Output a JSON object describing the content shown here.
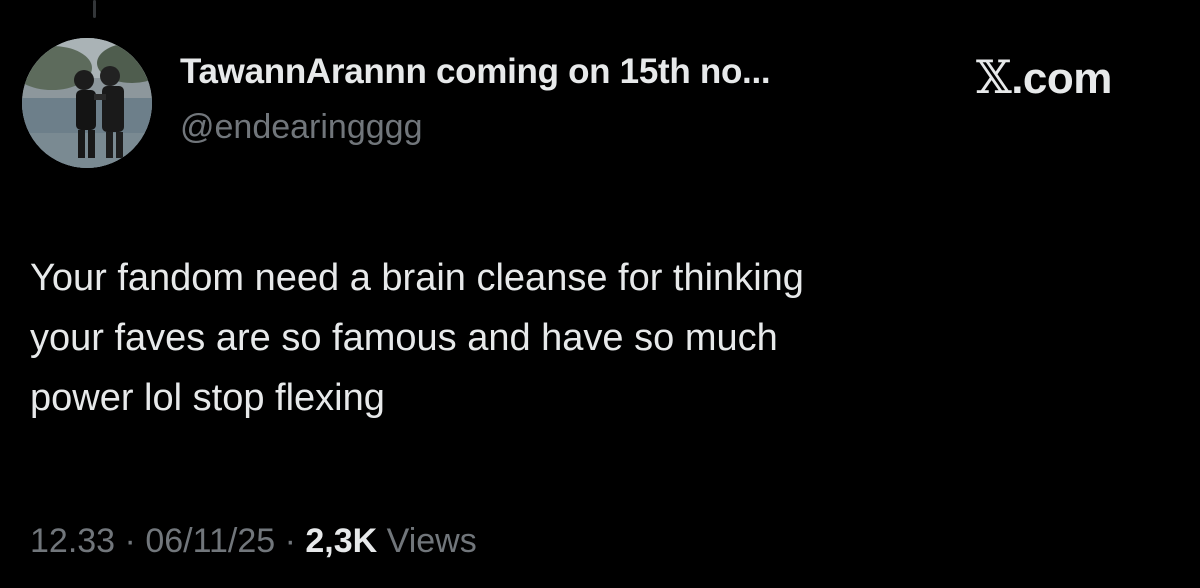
{
  "author": {
    "display_name": "TawannArannn coming on 15th no...",
    "handle": "@endearingggg",
    "avatar_icon": "profile-photo-avatar"
  },
  "brand": {
    "x_glyph": "𝕏",
    "suffix": ".com"
  },
  "tweet": {
    "lines": [
      "Your fandom need a brain cleanse for thinking",
      "your faves are so famous and have so much",
      "power lol stop flexing"
    ]
  },
  "meta": {
    "time": "12.33",
    "separator": " · ",
    "date": "06/11/25",
    "views_count": "2,3K",
    "views_label": " Views"
  },
  "colors": {
    "background": "#000000",
    "primary_text": "#e7e9ea",
    "secondary_text": "#71767b"
  }
}
